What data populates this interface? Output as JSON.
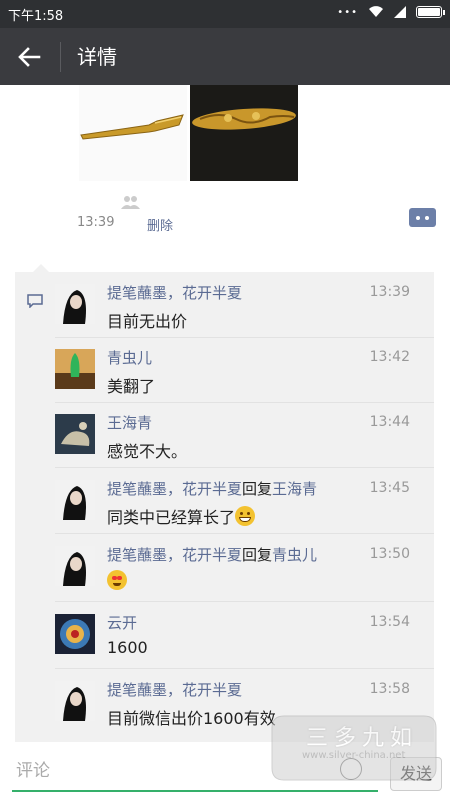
{
  "status_bar": {
    "time": "下午1:58"
  },
  "nav": {
    "title": "详情"
  },
  "post": {
    "time": "13:39",
    "delete_label": "删除"
  },
  "comments": [
    {
      "name": "提笔蘸墨，花开半夏",
      "reply_word": "",
      "reply_to": "",
      "time": "13:39",
      "text": "目前无出价",
      "emoji": ""
    },
    {
      "name": "青虫儿",
      "reply_word": "",
      "reply_to": "",
      "time": "13:42",
      "text": "美翻了",
      "emoji": ""
    },
    {
      "name": "王海青",
      "reply_word": "",
      "reply_to": "",
      "time": "13:44",
      "text": "感觉不大。",
      "emoji": ""
    },
    {
      "name": "提笔蘸墨，花开半夏",
      "reply_word": "回复",
      "reply_to": "王海青",
      "time": "13:45",
      "text": "同类中已经算长了",
      "emoji": "grin"
    },
    {
      "name": "提笔蘸墨，花开半夏",
      "reply_word": "回复",
      "reply_to": "青虫儿",
      "time": "13:50",
      "text": "",
      "emoji": "love"
    },
    {
      "name": "云开",
      "reply_word": "",
      "reply_to": "",
      "time": "13:54",
      "text": "1600",
      "emoji": ""
    },
    {
      "name": "提笔蘸墨，花开半夏",
      "reply_word": "",
      "reply_to": "",
      "time": "13:58",
      "text": "目前微信出价1600有效",
      "emoji": ""
    }
  ],
  "input": {
    "placeholder": "评论",
    "send_label": "发送"
  },
  "watermark": {
    "title": "三多九如",
    "url": "www.silver-china.net"
  }
}
